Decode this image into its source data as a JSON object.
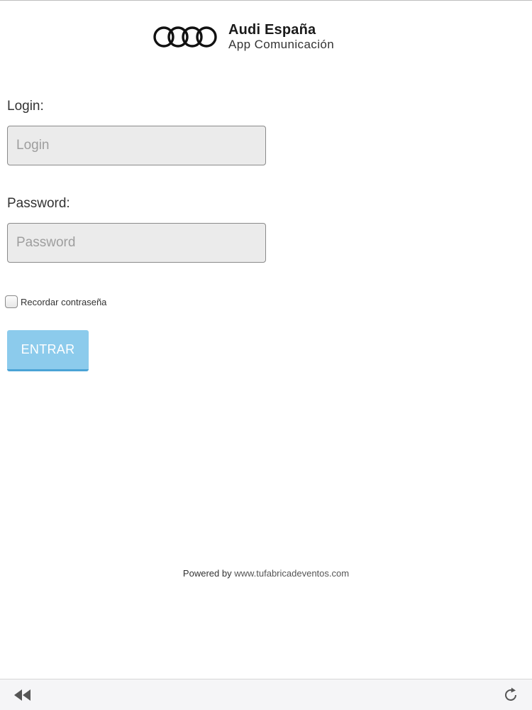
{
  "header": {
    "brand_title": "Audi España",
    "brand_subtitle": "App Comunicación",
    "logo_icon": "audi-rings-icon"
  },
  "form": {
    "login_label": "Login:",
    "login_placeholder": "Login",
    "login_value": "",
    "password_label": "Password:",
    "password_placeholder": "Password",
    "password_value": "",
    "remember_label": "Recordar contraseña",
    "remember_checked": false,
    "submit_label": "ENTRAR"
  },
  "footer": {
    "powered_by": "Powered by",
    "link": "www.tufabricadeventos.com"
  },
  "toolbar": {
    "back_icon": "rewind-icon",
    "reload_icon": "refresh-icon"
  },
  "colors": {
    "accent": "#8ccbec",
    "accent_border": "#4aa3d6",
    "input_bg": "#ebebeb"
  }
}
